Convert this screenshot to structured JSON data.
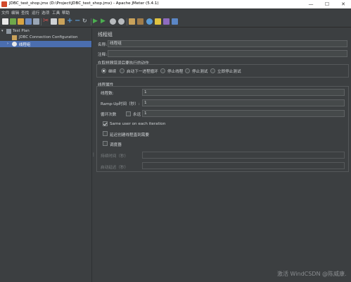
{
  "window": {
    "title": "JDBC_test_shop.jmx (D:\\Project\\JDBC_test_shop.jmx) - Apache JMeter (5.4.1)",
    "min": "—",
    "max": "☐",
    "close": "✕"
  },
  "menu": [
    "文件",
    "编辑",
    "查找",
    "运行",
    "选项",
    "工具",
    "帮助"
  ],
  "toolbar": {
    "icons": [
      "new-icon",
      "templates-icon",
      "open-icon",
      "save-icon",
      "saveas-icon",
      "cut-icon",
      "copy-icon",
      "paste-icon",
      "expand-icon",
      "collapse-icon",
      "toggle-icon",
      "start-icon",
      "start-no-pause-icon",
      "stop-icon",
      "shutdown-icon",
      "clear-icon",
      "clear-all-icon",
      "search-icon",
      "reset-search-icon",
      "function-helper-icon",
      "help-icon"
    ],
    "plus": "+",
    "minus": "−",
    "tilde": "↻"
  },
  "tree": {
    "items": [
      {
        "label": "Test Plan",
        "arrow": "▾"
      },
      {
        "label": "JDBC Connection Configuration",
        "arrow": ""
      },
      {
        "label": "线程组",
        "arrow": "›"
      }
    ]
  },
  "panel": {
    "title": "线程组",
    "name_label": "名称:",
    "name_value": "线程组",
    "comment_label": "注释:",
    "comment_value": "",
    "action_label": "在取样器错误后要执行的动作",
    "actions": [
      "继续",
      "启动下一进程循环",
      "停止线程",
      "停止测试",
      "立即停止测试"
    ],
    "selected_action": "继续",
    "props_label": "线程属性",
    "threads_label": "线程数:",
    "threads_value": "1",
    "rampup_label": "Ramp-Up时间（秒）:",
    "rampup_value": "1",
    "loop_label": "循环次数",
    "forever_label": "永远",
    "loop_value": "1",
    "same_user_label": "Same user on each iteration",
    "delay_label": "延迟创建线程直到需要",
    "scheduler_label": "调度器",
    "duration_label": "持续时间（秒）",
    "duration_value": "",
    "startup_delay_label": "启动延迟（秒）",
    "startup_delay_value": "",
    "splitter_dots": "⋮"
  },
  "watermark": "激活 WindCSDN @陈威康.",
  "colors": {
    "background": "#3c3f41",
    "selection": "#4b6eaf",
    "text": "#cfd2d5"
  }
}
